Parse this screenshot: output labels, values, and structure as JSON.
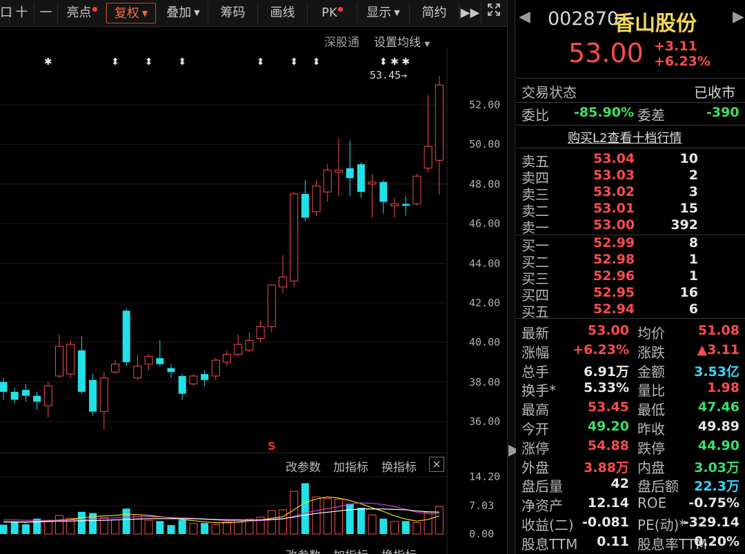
{
  "toolbar": {
    "items": [
      {
        "label": "口",
        "x": 0,
        "w": 14
      },
      {
        "label": "十",
        "x": 14,
        "w": 36
      },
      {
        "label": "一",
        "x": 50,
        "w": 34
      },
      {
        "label": "亮点",
        "dot": true
      },
      {
        "label": "复权",
        "caret": "▼",
        "active": true
      },
      {
        "label": "叠加",
        "caret": "▼"
      },
      {
        "label": "筹码"
      },
      {
        "label": "画线"
      },
      {
        "label": "PK",
        "dot": true
      },
      {
        "label": "显示",
        "caret": "▼"
      },
      {
        "label": "简约"
      },
      {
        "label": "▶▶"
      }
    ],
    "expand_icon": "expand-icon"
  },
  "chart_header": {
    "exchange": "深股通",
    "ma_setting": "设置均线",
    "ma_caret": "▼"
  },
  "stock": {
    "code": "002870",
    "name": "香山股份",
    "price": "53.00",
    "change": "+3.11",
    "change_pct": "+6.23%"
  },
  "status": {
    "label": "交易状态",
    "value": "已收市"
  },
  "ratio": {
    "wb_label": "委比",
    "wb_value": "-85.90%",
    "wc_label": "委差",
    "wc_value": "-390"
  },
  "l2_link": "购买L2查看十档行情",
  "order_book": {
    "asks": [
      {
        "label": "卖五",
        "price": "53.04",
        "vol": "10"
      },
      {
        "label": "卖四",
        "price": "53.03",
        "vol": "2"
      },
      {
        "label": "卖三",
        "price": "53.02",
        "vol": "3"
      },
      {
        "label": "卖二",
        "price": "53.01",
        "vol": "15"
      },
      {
        "label": "卖一",
        "price": "53.00",
        "vol": "392"
      }
    ],
    "bids": [
      {
        "label": "买一",
        "price": "52.99",
        "vol": "8"
      },
      {
        "label": "买二",
        "price": "52.98",
        "vol": "1"
      },
      {
        "label": "买三",
        "price": "52.96",
        "vol": "1"
      },
      {
        "label": "买四",
        "price": "52.95",
        "vol": "16"
      },
      {
        "label": "买五",
        "price": "52.94",
        "vol": "6"
      }
    ]
  },
  "stats": [
    {
      "l1": "最新",
      "v1": "53.00",
      "c1": "red",
      "l2": "均价",
      "v2": "51.08",
      "c2": "red"
    },
    {
      "l1": "涨幅",
      "v1": "+6.23%",
      "c1": "red",
      "l2": "涨跌",
      "v2": "▲3.11",
      "c2": "red"
    },
    {
      "l1": "总手",
      "v1": "6.91万",
      "c1": "white",
      "l2": "金额",
      "v2": "3.53亿",
      "c2": "cyan"
    },
    {
      "l1": "换手*",
      "v1": "5.33%",
      "c1": "white",
      "l2": "量比",
      "v2": "1.98",
      "c2": "red"
    },
    {
      "l1": "最高",
      "v1": "53.45",
      "c1": "red",
      "l2": "最低",
      "v2": "47.46",
      "c2": "green"
    },
    {
      "l1": "今开",
      "v1": "49.20",
      "c1": "green",
      "l2": "昨收",
      "v2": "49.89",
      "c2": "white"
    },
    {
      "l1": "涨停",
      "v1": "54.88",
      "c1": "red",
      "l2": "跌停",
      "v2": "44.90",
      "c2": "green"
    },
    {
      "l1": "外盘",
      "v1": "3.88万",
      "c1": "red",
      "l2": "内盘",
      "v2": "3.03万",
      "c2": "green"
    },
    {
      "l1": "盘后量",
      "v1": "42",
      "c1": "white",
      "l2": "盘后额",
      "v2": "22.3万",
      "c2": "cyan"
    },
    {
      "l1": "净资产",
      "v1": "12.14",
      "c1": "white",
      "l2": "ROE",
      "v2": "-0.75%",
      "c2": "white"
    },
    {
      "l1": "收益(二)",
      "v1": "-0.081",
      "c1": "white",
      "l2": "PE(动)*",
      "v2": "-329.14",
      "c2": "white"
    },
    {
      "l1": "股息TTM",
      "v1": "0.11",
      "c1": "white",
      "l2": "股息率TTM",
      "v2": "0.20%",
      "c2": "white"
    }
  ],
  "indicator_bar": {
    "change_params": "改参数",
    "add_indicator": "加指标",
    "switch_indicator": "换指标",
    "close": "×"
  },
  "indicator_bar2": {
    "change_params": "改参数",
    "add_indicator": "加指标",
    "switch_indicator": "换指标"
  },
  "colors": {
    "up": "#ff4c4c",
    "down": "#22e0e8",
    "ma1": "#e8e020",
    "ma2": "#d040d0",
    "ma3": "#ffffff"
  },
  "chart_data": {
    "type": "candlestick",
    "price_axis": [
      "52.00",
      "50.00",
      "48.00",
      "46.00",
      "44.00",
      "42.00",
      "40.00",
      "38.00",
      "36.00"
    ],
    "ylim": [
      35.0,
      54.5
    ],
    "max_label": "53.45",
    "candles": [
      {
        "o": 38.0,
        "c": 37.5,
        "h": 38.2,
        "l": 37.1
      },
      {
        "o": 37.5,
        "c": 37.1,
        "h": 37.7,
        "l": 36.9
      },
      {
        "o": 37.6,
        "c": 37.3,
        "h": 37.9,
        "l": 37.0
      },
      {
        "o": 37.3,
        "c": 37.0,
        "h": 37.5,
        "l": 36.6
      },
      {
        "o": 36.8,
        "c": 37.8,
        "h": 38.0,
        "l": 36.2
      },
      {
        "o": 38.3,
        "c": 39.8,
        "h": 40.4,
        "l": 38.2
      },
      {
        "o": 38.4,
        "c": 39.9,
        "h": 40.1,
        "l": 38.2
      },
      {
        "o": 39.6,
        "c": 37.5,
        "h": 40.3,
        "l": 37.4
      },
      {
        "o": 38.1,
        "c": 36.5,
        "h": 38.4,
        "l": 36.3
      },
      {
        "o": 36.5,
        "c": 38.2,
        "h": 38.5,
        "l": 35.6
      },
      {
        "o": 38.5,
        "c": 38.9,
        "h": 39.1,
        "l": 38.4
      },
      {
        "o": 41.6,
        "c": 39.0,
        "h": 41.7,
        "l": 38.8
      },
      {
        "o": 38.2,
        "c": 38.8,
        "h": 39.4,
        "l": 38.1
      },
      {
        "o": 38.9,
        "c": 39.3,
        "h": 39.4,
        "l": 38.6
      },
      {
        "o": 39.2,
        "c": 38.9,
        "h": 40.1,
        "l": 38.8
      },
      {
        "o": 38.7,
        "c": 38.5,
        "h": 38.9,
        "l": 38.2
      },
      {
        "o": 38.3,
        "c": 37.4,
        "h": 38.4,
        "l": 37.1
      },
      {
        "o": 37.9,
        "c": 38.3,
        "h": 38.4,
        "l": 37.8
      },
      {
        "o": 38.4,
        "c": 38.1,
        "h": 38.6,
        "l": 37.8
      },
      {
        "o": 38.3,
        "c": 39.1,
        "h": 39.2,
        "l": 38.1
      },
      {
        "o": 39.0,
        "c": 39.4,
        "h": 39.6,
        "l": 38.8
      },
      {
        "o": 39.4,
        "c": 39.9,
        "h": 40.4,
        "l": 39.3
      },
      {
        "o": 39.6,
        "c": 40.1,
        "h": 40.5,
        "l": 39.5
      },
      {
        "o": 40.2,
        "c": 40.8,
        "h": 41.1,
        "l": 40.0
      },
      {
        "o": 40.8,
        "c": 42.9,
        "h": 42.9,
        "l": 40.5
      },
      {
        "o": 42.8,
        "c": 43.3,
        "h": 44.4,
        "l": 42.5
      },
      {
        "o": 43.1,
        "c": 47.5,
        "h": 47.6,
        "l": 42.8
      },
      {
        "o": 47.5,
        "c": 46.3,
        "h": 48.2,
        "l": 46.1
      },
      {
        "o": 46.6,
        "c": 47.9,
        "h": 48.2,
        "l": 46.4
      },
      {
        "o": 47.6,
        "c": 48.7,
        "h": 49.0,
        "l": 47.1
      },
      {
        "o": 48.6,
        "c": 48.7,
        "h": 50.3,
        "l": 47.4
      },
      {
        "o": 48.8,
        "c": 48.3,
        "h": 50.2,
        "l": 47.4
      },
      {
        "o": 49.0,
        "c": 47.6,
        "h": 49.1,
        "l": 47.3
      },
      {
        "o": 48.0,
        "c": 48.1,
        "h": 48.5,
        "l": 46.3
      },
      {
        "o": 48.1,
        "c": 47.1,
        "h": 48.2,
        "l": 46.5
      },
      {
        "o": 46.9,
        "c": 47.0,
        "h": 47.3,
        "l": 46.3
      },
      {
        "o": 47.0,
        "c": 46.9,
        "h": 47.4,
        "l": 46.4
      },
      {
        "o": 47.0,
        "c": 48.4,
        "h": 48.5,
        "l": 46.9
      },
      {
        "o": 48.8,
        "c": 49.9,
        "h": 52.5,
        "l": 48.6
      },
      {
        "o": 49.2,
        "c": 53.0,
        "h": 53.45,
        "l": 47.46
      }
    ],
    "volume_axis": [
      "14.20",
      "7.03",
      "0.00"
    ],
    "volume_ylim": [
      0,
      14.2
    ],
    "volumes": [
      2.3,
      3.1,
      2.4,
      3.8,
      3.2,
      4.6,
      3.9,
      5.5,
      5.2,
      4.1,
      3.5,
      6.3,
      4.8,
      3.4,
      3.2,
      2.2,
      3.5,
      2.6,
      2.7,
      2.3,
      3.0,
      3.5,
      3.7,
      4.2,
      5.8,
      6.0,
      10.6,
      12.6,
      9.2,
      8.8,
      8.6,
      7.5,
      6.5,
      4.7,
      3.8,
      3.1,
      3.2,
      2.8,
      5.4,
      6.8
    ],
    "ma_lines": [
      {
        "color": "#e8e020",
        "values": [
          3.0,
          3.0,
          2.9,
          3.1,
          3.2,
          3.5,
          3.6,
          4.0,
          4.3,
          4.5,
          4.6,
          4.9,
          4.8,
          4.6,
          4.3,
          4.0,
          3.6,
          3.3,
          3.0,
          2.8,
          2.8,
          2.9,
          3.2,
          3.4,
          3.9,
          4.3,
          6.0,
          7.8,
          8.7,
          9.2,
          8.9,
          8.3,
          7.5,
          6.5,
          5.6,
          4.5,
          3.7,
          3.2,
          3.6,
          4.5
        ]
      },
      {
        "color": "#d040d0",
        "values": [
          3.5,
          3.5,
          3.4,
          3.4,
          3.4,
          3.4,
          3.5,
          3.6,
          3.7,
          3.9,
          4.0,
          4.2,
          4.3,
          4.3,
          4.2,
          4.1,
          4.0,
          3.9,
          3.7,
          3.5,
          3.3,
          3.2,
          3.2,
          3.3,
          3.5,
          3.7,
          4.4,
          5.2,
          5.8,
          6.3,
          6.8,
          7.4,
          7.7,
          7.6,
          7.3,
          6.8,
          6.1,
          5.4,
          5.0,
          5.0
        ]
      },
      {
        "color": "#ffffff",
        "values": [
          3.0,
          3.0,
          3.0,
          3.0,
          3.1,
          3.2,
          3.2,
          3.3,
          3.3,
          3.4,
          3.5,
          3.6,
          3.7,
          3.8,
          3.8,
          3.8,
          3.8,
          3.8,
          3.7,
          3.6,
          3.5,
          3.5,
          3.4,
          3.5,
          3.6,
          3.8,
          4.2,
          4.7,
          5.1,
          5.4,
          5.7,
          6.0,
          6.2,
          6.2,
          6.2,
          6.1,
          6.0,
          5.7,
          5.5,
          5.4
        ]
      }
    ],
    "markers": [
      {
        "i": 4,
        "sym": "✱"
      },
      {
        "i": 10,
        "sym": "⬍"
      },
      {
        "i": 13,
        "sym": "⬍"
      },
      {
        "i": 16,
        "sym": "⬍"
      },
      {
        "i": 23,
        "sym": "⬍"
      },
      {
        "i": 26,
        "sym": "⬍"
      },
      {
        "i": 28,
        "sym": "⬍"
      },
      {
        "i": 34,
        "sym": "⬍"
      },
      {
        "i": 35,
        "sym": "✱"
      },
      {
        "i": 36,
        "sym": "✱"
      }
    ],
    "signal": {
      "i": 24,
      "sym": "S"
    }
  }
}
